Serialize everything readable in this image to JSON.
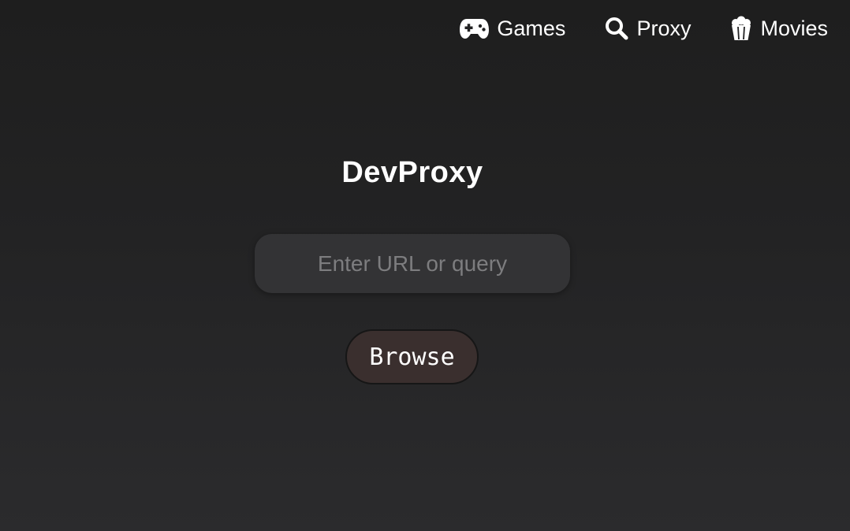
{
  "nav": {
    "items": [
      {
        "label": "Games",
        "icon": "gamepad-icon"
      },
      {
        "label": "Proxy",
        "icon": "search-icon"
      },
      {
        "label": "Movies",
        "icon": "popcorn-icon"
      }
    ]
  },
  "main": {
    "title": "DevProxy",
    "search_placeholder": "Enter URL or query",
    "search_value": "",
    "browse_label": "Browse"
  },
  "colors": {
    "background_top": "#1e1e1e",
    "background_bottom": "#2b2b2d",
    "input_bg": "#333335",
    "button_bg": "#3a2f2e",
    "text": "#ffffff",
    "placeholder": "#7d7d7f"
  }
}
